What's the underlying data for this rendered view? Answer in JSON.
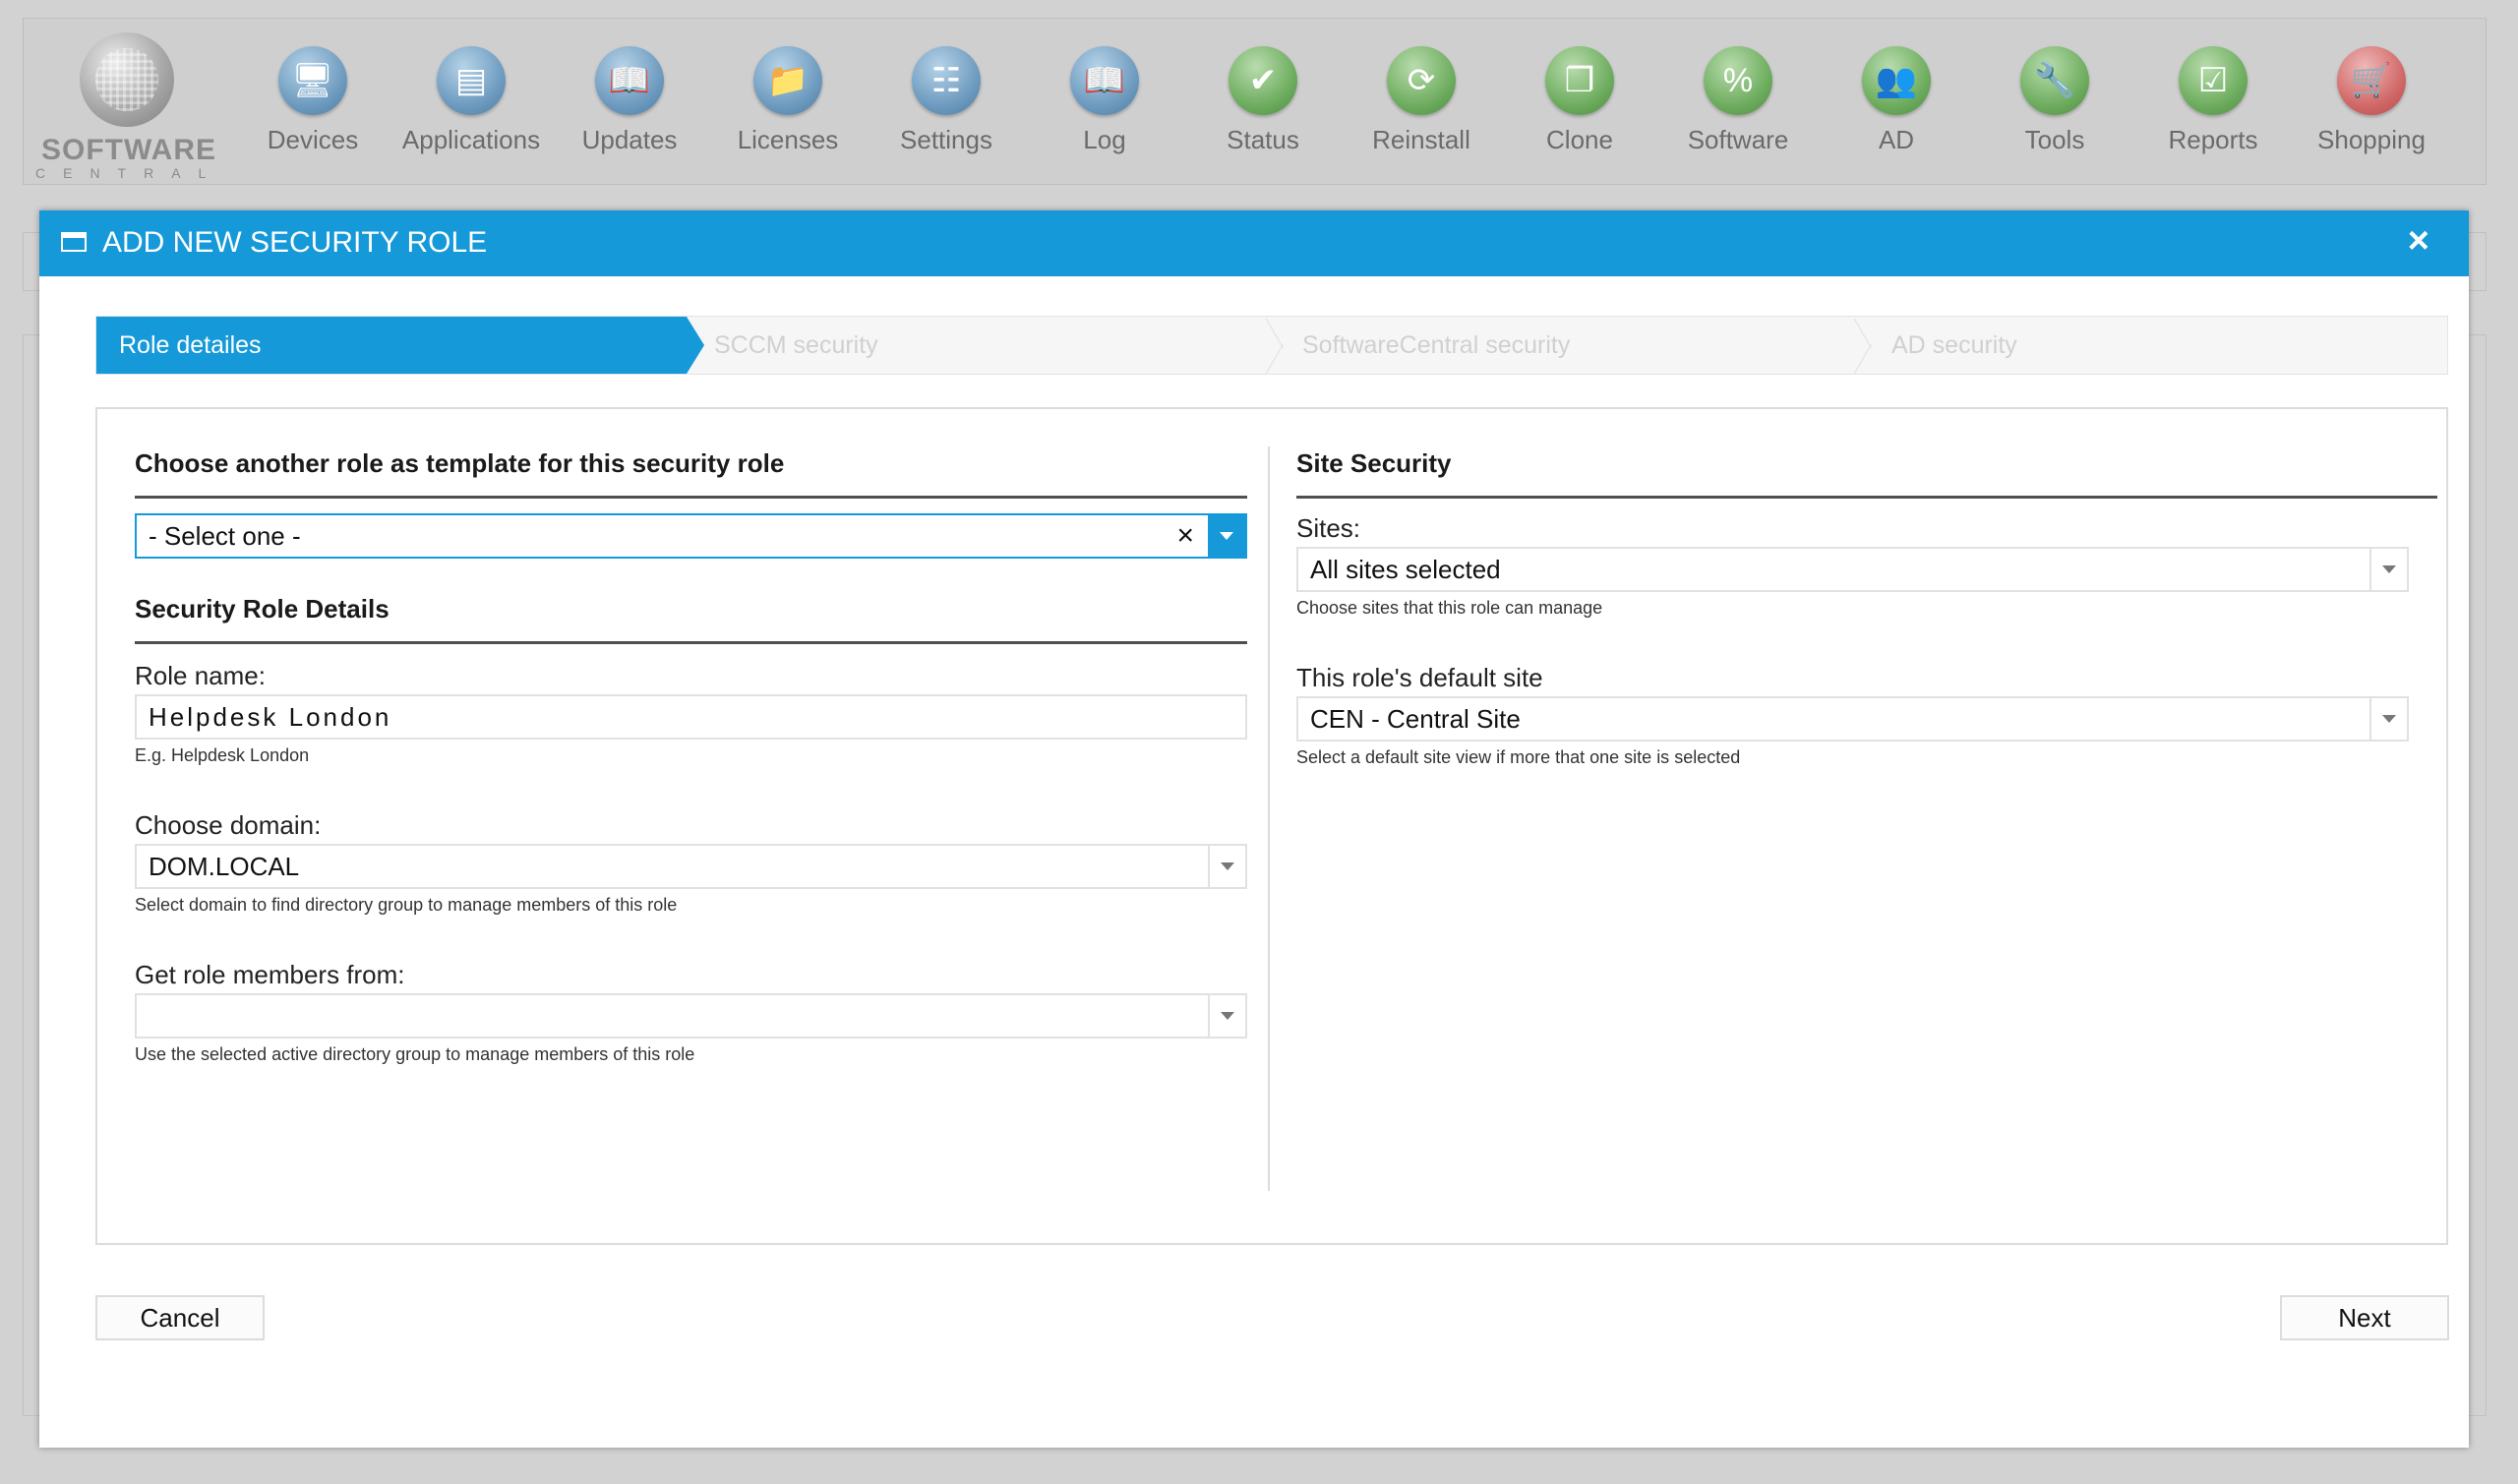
{
  "app": {
    "logo_line1": "SOFTWARE",
    "logo_line2": "CENTRAL",
    "nav": [
      {
        "label": "Devices",
        "icon": "monitor-icon",
        "glyph": "🖥",
        "color": "blue"
      },
      {
        "label": "Applications",
        "icon": "applications-icon",
        "glyph": "▤",
        "color": "blue"
      },
      {
        "label": "Updates",
        "icon": "book-icon",
        "glyph": "📖",
        "color": "blue"
      },
      {
        "label": "Licenses",
        "icon": "folder-icon",
        "glyph": "📁",
        "color": "blue"
      },
      {
        "label": "Settings",
        "icon": "settings-icon",
        "glyph": "☷",
        "color": "blue"
      },
      {
        "label": "Log",
        "icon": "log-book-icon",
        "glyph": "📖",
        "color": "blue"
      },
      {
        "label": "Status",
        "icon": "checkmark-icon",
        "glyph": "✔",
        "color": "green"
      },
      {
        "label": "Reinstall",
        "icon": "refresh-icon",
        "glyph": "⟳",
        "color": "green"
      },
      {
        "label": "Clone",
        "icon": "clone-icon",
        "glyph": "❐",
        "color": "green"
      },
      {
        "label": "Software",
        "icon": "percent-icon",
        "glyph": "%",
        "color": "green"
      },
      {
        "label": "AD",
        "icon": "users-icon",
        "glyph": "👥",
        "color": "green"
      },
      {
        "label": "Tools",
        "icon": "wrench-icon",
        "glyph": "🔧",
        "color": "green"
      },
      {
        "label": "Reports",
        "icon": "report-check-icon",
        "glyph": "☑",
        "color": "green"
      },
      {
        "label": "Shopping",
        "icon": "cart-icon",
        "glyph": "🛒",
        "color": "red"
      }
    ]
  },
  "dialog": {
    "title": "ADD NEW SECURITY ROLE",
    "close_glyph": "×",
    "steps": [
      "Role detailes",
      "SCCM security",
      "SoftwareCentral security",
      "AD security"
    ],
    "left": {
      "template_header": "Choose another role as template for this security role",
      "template_select": {
        "value": "- Select one -",
        "clear_glyph": "×"
      },
      "details_header": "Security Role Details",
      "role_name_label": "Role name:",
      "role_name_value": "Helpdesk London",
      "role_name_hint": "E.g. Helpdesk London",
      "domain_label": "Choose domain:",
      "domain_value": "DOM.LOCAL",
      "domain_hint": "Select domain to find directory group to manage members of this role",
      "members_label": "Get role members from:",
      "members_value": "",
      "members_hint": "Use the selected active directory group to manage members of this role"
    },
    "right": {
      "site_header": "Site Security",
      "sites_label": "Sites:",
      "sites_value": "All sites selected",
      "sites_hint": "Choose sites that this role can manage",
      "default_site_label": "This role's default site",
      "default_site_value": "CEN - Central Site",
      "default_site_hint": "Select a default site view if more that one site is selected"
    },
    "buttons": {
      "cancel": "Cancel",
      "next": "Next"
    }
  },
  "colors": {
    "accent": "#1599d8",
    "background": "#d2d2d2"
  }
}
